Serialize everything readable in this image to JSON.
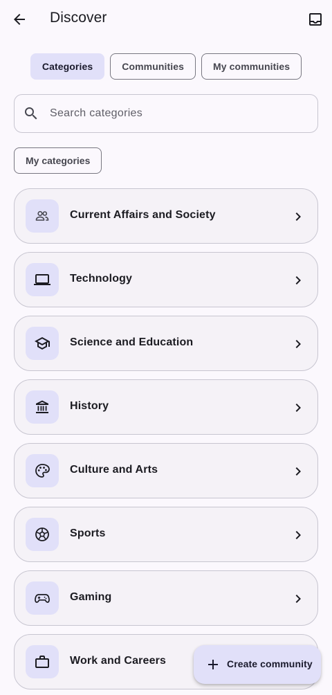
{
  "header": {
    "title": "Discover",
    "back_icon": "arrow-back-icon",
    "inbox_icon": "inbox-icon"
  },
  "tabs": [
    {
      "label": "Categories",
      "selected": true
    },
    {
      "label": "Communities",
      "selected": false
    },
    {
      "label": "My communities",
      "selected": false
    }
  ],
  "search": {
    "placeholder": "Search categories",
    "value": "",
    "icon": "search-icon"
  },
  "filter": {
    "my_categories_label": "My categories"
  },
  "categories": [
    {
      "label": "Current Affairs and Society",
      "icon": "people-icon"
    },
    {
      "label": "Technology",
      "icon": "laptop-icon"
    },
    {
      "label": "Science and Education",
      "icon": "school-icon"
    },
    {
      "label": "History",
      "icon": "museum-icon"
    },
    {
      "label": "Culture and Arts",
      "icon": "palette-icon"
    },
    {
      "label": "Sports",
      "icon": "ball-icon"
    },
    {
      "label": "Gaming",
      "icon": "gamepad-icon"
    },
    {
      "label": "Work and Careers",
      "icon": "briefcase-icon"
    }
  ],
  "fab": {
    "label": "Create community",
    "icon": "plus-icon"
  },
  "colors": {
    "background": "#fbf8fd",
    "card": "#f5f2f7",
    "accent_container": "#e1e0f9",
    "outline": "#c7c5d0",
    "on_surface": "#1b1b21"
  }
}
